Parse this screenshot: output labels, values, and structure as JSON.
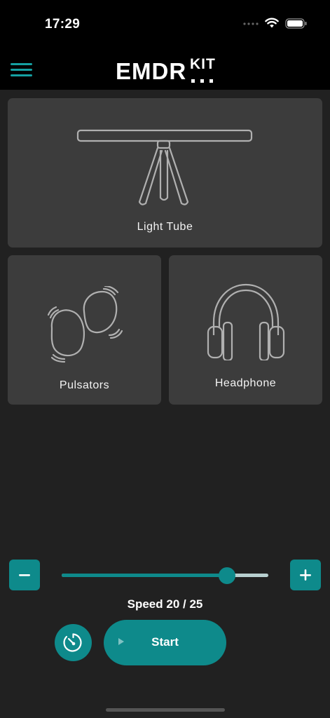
{
  "status_bar": {
    "time": "17:29"
  },
  "header": {
    "logo_main": "EMDR",
    "logo_sub": "KIT"
  },
  "devices": [
    {
      "label": "Light Tube",
      "icon": "light-tube-icon"
    },
    {
      "label": "Pulsators",
      "icon": "pulsators-icon"
    },
    {
      "label": "Headphone",
      "icon": "headphone-icon"
    }
  ],
  "speed": {
    "label": "Speed 20 / 25",
    "value": 20,
    "max": 25
  },
  "controls": {
    "start_label": "Start"
  },
  "colors": {
    "accent": "#0e8a8b",
    "background": "#212121",
    "card": "#3c3c3c"
  }
}
